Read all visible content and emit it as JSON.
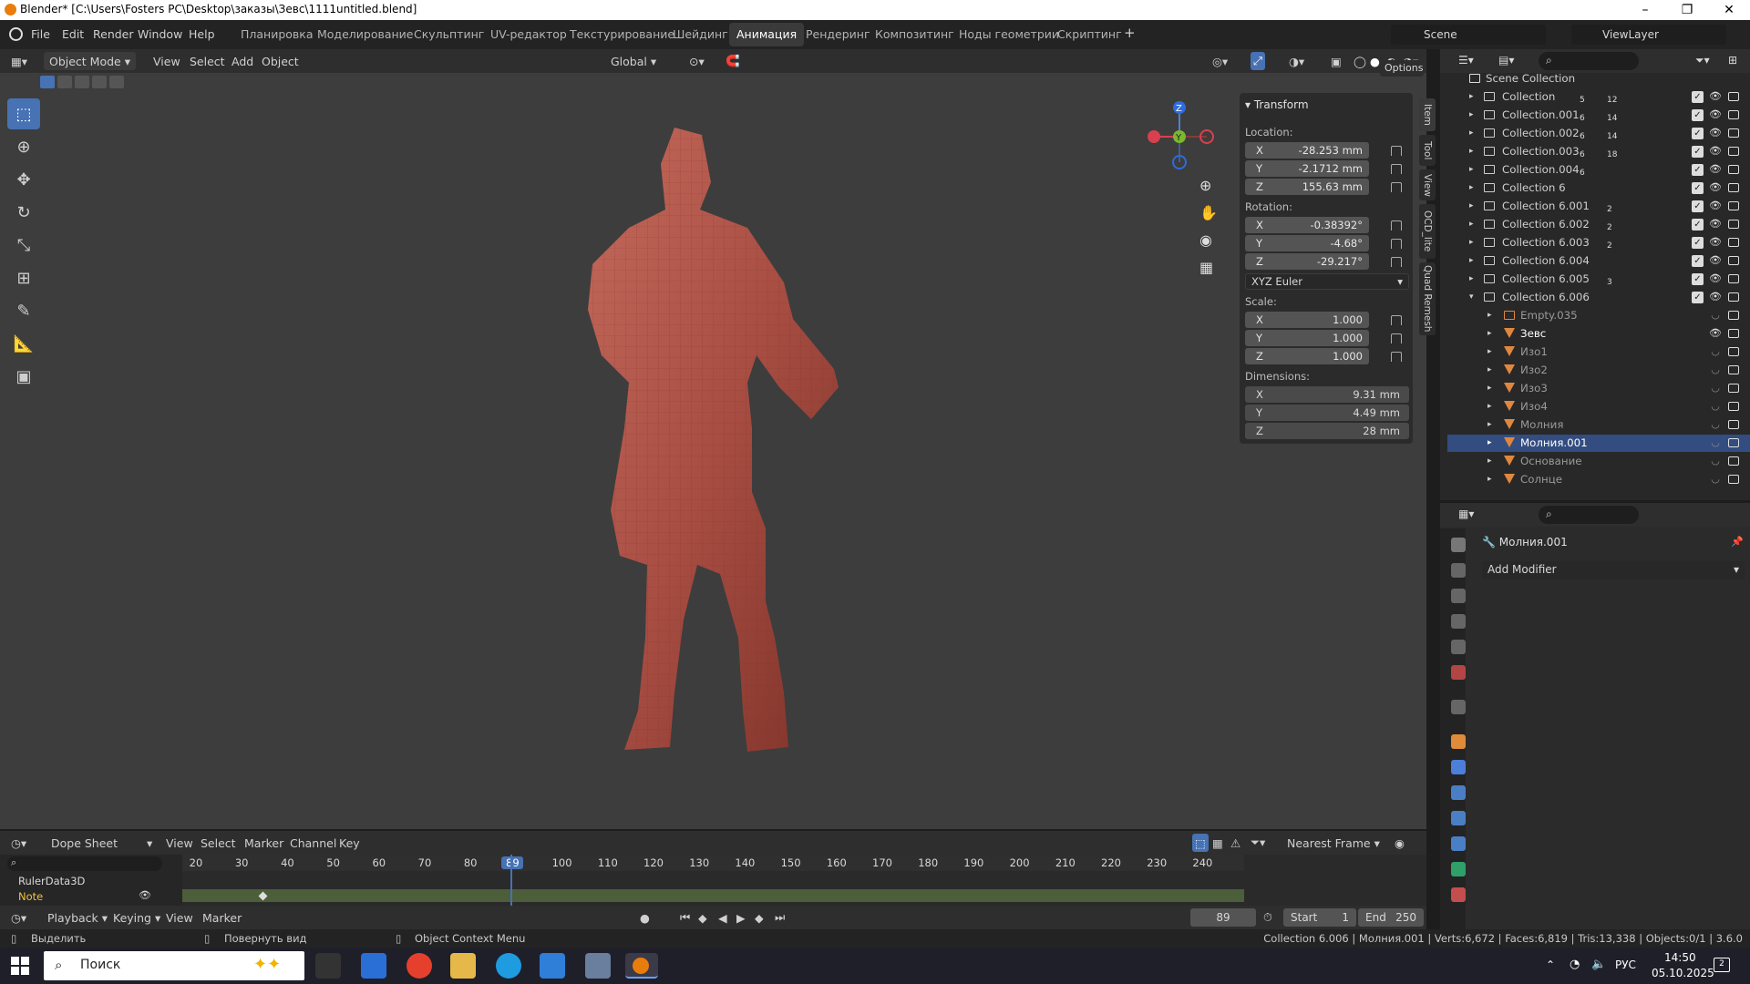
{
  "title": {
    "text": "Blender* [C:\\Users\\Fosters PC\\Desktop\\заказы\\Зевс\\1111untitled.blend]"
  },
  "menu": {
    "file": "File",
    "edit": "Edit",
    "render": "Render",
    "window": "Window",
    "help": "Help"
  },
  "workspaces": [
    "Планировка",
    "Моделирование",
    "Скульптинг",
    "UV-редактор",
    "Текстурирование",
    "Шейдинг",
    "Анимация",
    "Рендеринг",
    "Композитинг",
    "Ноды геометрии",
    "Скриптинг"
  ],
  "scene": {
    "label": "Scene",
    "viewlayer": "ViewLayer"
  },
  "viewport_header": {
    "mode": "Object Mode",
    "view": "View",
    "select": "Select",
    "add": "Add",
    "object": "Object",
    "orientation": "Global",
    "options": "Options"
  },
  "npanel": {
    "section": "Transform",
    "location_label": "Location:",
    "location": [
      {
        "axis": "X",
        "value": "-28.253 mm"
      },
      {
        "axis": "Y",
        "value": "-2.1712 mm"
      },
      {
        "axis": "Z",
        "value": "155.63 mm"
      }
    ],
    "rotation_label": "Rotation:",
    "rotation": [
      {
        "axis": "X",
        "value": "-0.38392°"
      },
      {
        "axis": "Y",
        "value": "-4.68°"
      },
      {
        "axis": "Z",
        "value": "-29.217°"
      }
    ],
    "rotation_mode": "XYZ Euler",
    "scale_label": "Scale:",
    "scale": [
      {
        "axis": "X",
        "value": "1.000"
      },
      {
        "axis": "Y",
        "value": "1.000"
      },
      {
        "axis": "Z",
        "value": "1.000"
      }
    ],
    "dimensions_label": "Dimensions:",
    "dimensions": [
      {
        "axis": "X",
        "value": "9.31 mm"
      },
      {
        "axis": "Y",
        "value": "4.49 mm"
      },
      {
        "axis": "Z",
        "value": "28 mm"
      }
    ],
    "tabs": [
      "Item",
      "Tool",
      "View",
      "OCD_lite",
      "Quad Remesh"
    ]
  },
  "gizmo": {
    "z": "Z",
    "y": "Y"
  },
  "outliner": {
    "root": "Scene Collection",
    "rows": [
      {
        "name": "Collection",
        "badge1": "5",
        "badge2": "12"
      },
      {
        "name": "Collection.001",
        "badge1": "6",
        "badge2": "14"
      },
      {
        "name": "Collection.002",
        "badge1": "6",
        "badge2": "14"
      },
      {
        "name": "Collection.003",
        "badge1": "6",
        "badge2": "18"
      },
      {
        "name": "Collection.004",
        "badge1": "6",
        "badge2": ""
      },
      {
        "name": "Collection 6",
        "badge1": "",
        "badge2": ""
      },
      {
        "name": "Collection 6.001",
        "badge1": "",
        "badge2": "2"
      },
      {
        "name": "Collection 6.002",
        "badge1": "",
        "badge2": "2"
      },
      {
        "name": "Collection 6.003",
        "badge1": "",
        "badge2": "2"
      },
      {
        "name": "Collection 6.004",
        "badge1": "",
        "badge2": ""
      },
      {
        "name": "Collection 6.005",
        "badge1": "",
        "badge2": "3"
      },
      {
        "name": "Collection 6.006",
        "badge1": "",
        "badge2": ""
      }
    ],
    "children": [
      "Empty.035",
      "Зевс",
      "Изо1",
      "Изо2",
      "Изо3",
      "Изо4",
      "Молния",
      "Молния.001",
      "Основание",
      "Солнце"
    ]
  },
  "properties": {
    "object": "Молния.001",
    "add_modifier": "Add Modifier"
  },
  "dopesheet": {
    "mode": "Dope Sheet",
    "view": "View",
    "select": "Select",
    "marker": "Marker",
    "channel": "Channel",
    "key": "Key",
    "snap": "Nearest Frame",
    "ticks": [
      "20",
      "30",
      "40",
      "50",
      "60",
      "70",
      "80",
      "89",
      "100",
      "110",
      "120",
      "130",
      "140",
      "150",
      "160",
      "170",
      "180",
      "190",
      "200",
      "210",
      "220",
      "230",
      "240"
    ],
    "channels": [
      "RulerData3D",
      "Note"
    ],
    "current_frame": 89
  },
  "playback": {
    "playback": "Playback",
    "keying": "Keying",
    "view": "View",
    "marker": "Marker",
    "frame": "89",
    "start_label": "Start",
    "start": "1",
    "end_label": "End",
    "end": "250"
  },
  "status": {
    "select": "Выделить",
    "rotate": "Повернуть вид",
    "context": "Object Context Menu",
    "stats": "Collection 6.006 | Молния.001 | Verts:6,672 | Faces:6,819 | Tris:13,338 | Objects:0/1 | 3.6.0"
  },
  "taskbar": {
    "search": "Поиск",
    "lang": "РУС",
    "time": "14:50",
    "date": "05.10.2025",
    "notif": "2"
  }
}
